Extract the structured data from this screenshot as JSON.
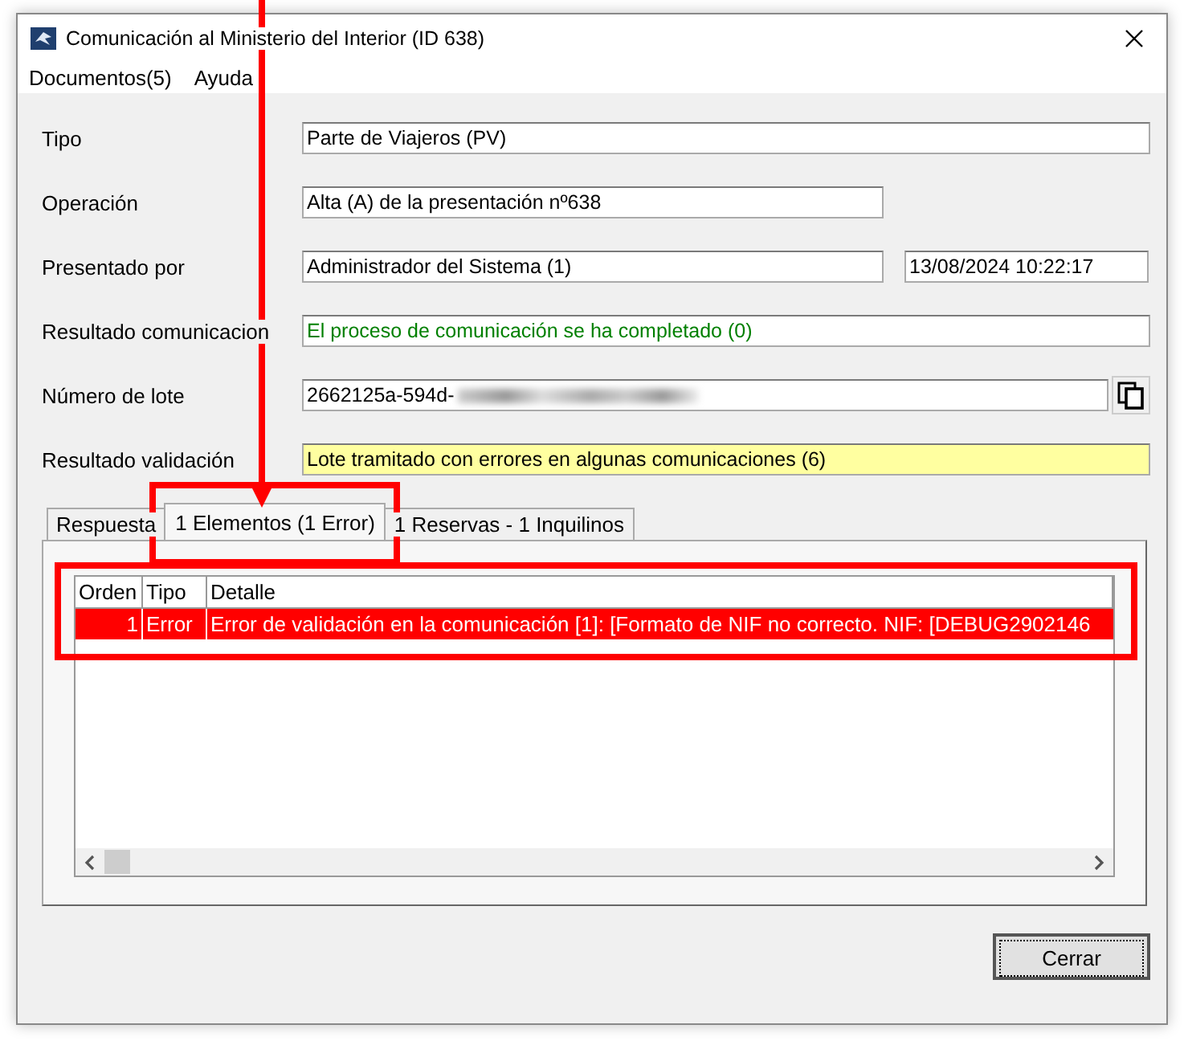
{
  "window": {
    "title": "Comunicación al Ministerio del Interior (ID 638)"
  },
  "menu": [
    "Documentos(5)",
    "Ayuda"
  ],
  "fields": [
    {
      "label": "Tipo",
      "kind": "text",
      "values": [
        "Parte de Viajeros (PV)"
      ]
    },
    {
      "label": "Operación",
      "kind": "short",
      "values": [
        "Alta (A) de la presentación nº638"
      ]
    },
    {
      "label": "Presentado por",
      "kind": "pair",
      "values": [
        "Administrador del Sistema (1)",
        "13/08/2024  10:22:17"
      ]
    },
    {
      "label": "Resultado comunicacion",
      "kind": "success",
      "values": [
        "El proceso de comunicación se ha completado (0)"
      ]
    },
    {
      "label": "Número de lote",
      "kind": "redacted",
      "values": [
        "2662125a-594d-"
      ]
    },
    {
      "label": "Resultado validación",
      "kind": "warning",
      "values": [
        "Lote tramitado con errores en algunas comunicaciones (6)"
      ]
    }
  ],
  "tabs": [
    {
      "label": "Respuesta",
      "selected": false
    },
    {
      "label": "1 Elementos (1 Error)",
      "selected": true
    },
    {
      "label": "1 Reservas - 1 Inquilinos",
      "selected": false
    }
  ],
  "table": {
    "columns": [
      "Orden",
      "Tipo",
      "Detalle"
    ],
    "rows": [
      {
        "kind": "error",
        "cells": [
          "1",
          "Error",
          "Error de validación en la comunicación [1]: [Formato de NIF no correcto.  NIF: [DEBUG2902146"
        ]
      }
    ]
  },
  "buttons": [
    "Cerrar"
  ]
}
